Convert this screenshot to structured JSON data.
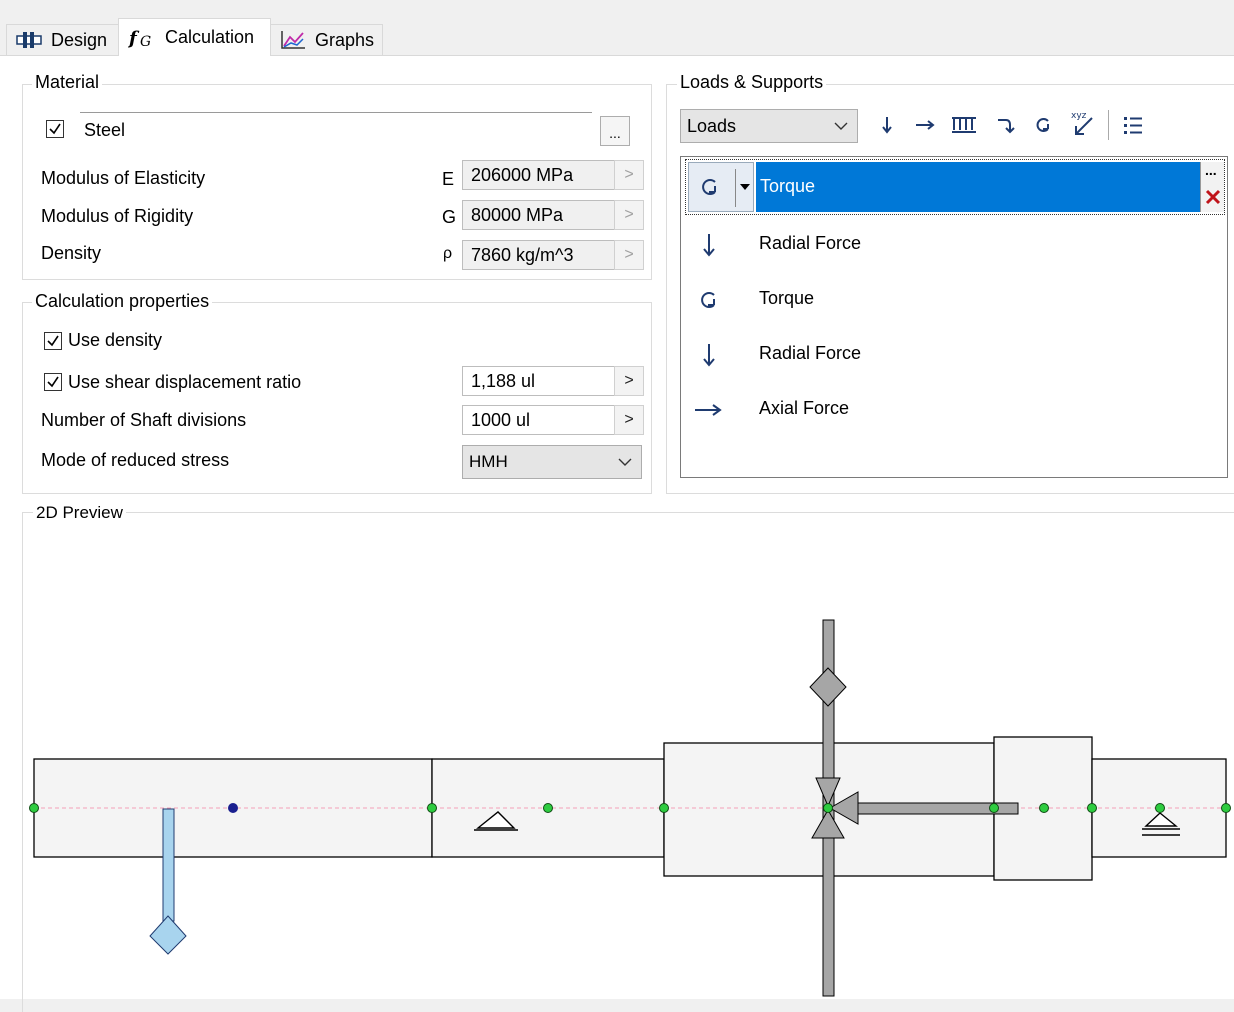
{
  "tabs": [
    {
      "label": "Design",
      "icon": "design-icon",
      "active": false
    },
    {
      "label": "Calculation",
      "icon": "function-icon",
      "active": true
    },
    {
      "label": "Graphs",
      "icon": "graph-icon",
      "active": false
    }
  ],
  "material": {
    "title": "Material",
    "name": "Steel",
    "browse_label": "...",
    "properties": [
      {
        "label": "Modulus of Elasticity",
        "symbol": "E",
        "value": "206000 MPa"
      },
      {
        "label": "Modulus of Rigidity",
        "symbol": "G",
        "value": "80000 MPa"
      },
      {
        "label": "Density",
        "symbol": "ρ",
        "value": "7860 kg/m^3"
      }
    ]
  },
  "calc": {
    "title": "Calculation properties",
    "use_density": "Use density",
    "use_shear": "Use shear displacement ratio",
    "shear_value": "1,188 ul",
    "divisions_label": "Number of Shaft divisions",
    "divisions_value": "1000 ul",
    "mode_label": "Mode of reduced stress",
    "mode_value": "HMH"
  },
  "loads": {
    "title": "Loads & Supports",
    "dropdown": "Loads",
    "selected": "Torque",
    "items": [
      {
        "label": "Radial Force",
        "icon": "radial-force-icon"
      },
      {
        "label": "Torque",
        "icon": "torque-icon"
      },
      {
        "label": "Radial Force",
        "icon": "radial-force-icon"
      },
      {
        "label": "Axial Force",
        "icon": "axial-force-icon"
      }
    ]
  },
  "preview": {
    "title": "2D Preview"
  },
  "colors": {
    "selection": "#0078d7",
    "shaft_fill": "#f4f4f4",
    "node": "#2ecc40",
    "load_blue": "#a8d4ee",
    "load_gray": "#a6a6a6"
  }
}
